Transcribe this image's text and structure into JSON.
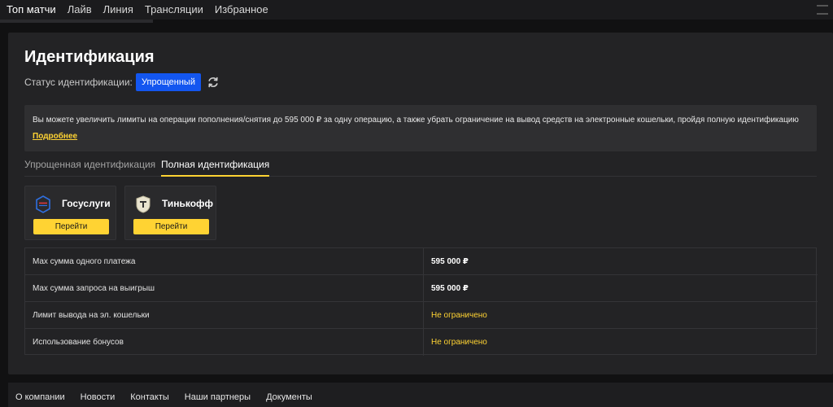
{
  "topnav": {
    "items": [
      "Топ матчи",
      "Лайв",
      "Линия",
      "Трансляции",
      "Избранное"
    ]
  },
  "identification": {
    "title": "Идентификация",
    "status_label": "Статус идентификации:",
    "status_value": "Упрощенный",
    "notice_text": "Вы можете увеличить лимиты на операции пополнения/снятия до 595 000 ₽ за одну операцию, а также убрать ограничение на вывод средств на электронные кошельки, пройдя полную идентификацию",
    "notice_link": "Подробнее",
    "tabs": [
      {
        "label": "Упрощенная идентификация",
        "active": false
      },
      {
        "label": "Полная идентификация",
        "active": true
      }
    ],
    "providers": [
      {
        "name": "Госуслуги",
        "button": "Перейти",
        "icon": "gosuslugi-logo"
      },
      {
        "name": "Тинькофф",
        "button": "Перейти",
        "icon": "tinkoff-logo"
      }
    ],
    "limits": [
      {
        "label": "Мax сумма одного платежа",
        "value": "595 000 ₽"
      },
      {
        "label": "Мax сумма запроса на выигрыш",
        "value": "595 000 ₽"
      },
      {
        "label": "Лимит вывода на эл. кошельки",
        "value": "Не ограничено"
      },
      {
        "label": "Использование бонусов",
        "value": "Не ограничено"
      }
    ]
  },
  "footer": {
    "links": [
      "О компании",
      "Новости",
      "Контакты",
      "Наши партнеры",
      "Документы"
    ]
  },
  "colors": {
    "accent": "#ffd333",
    "status_badge": "#1356f0"
  }
}
